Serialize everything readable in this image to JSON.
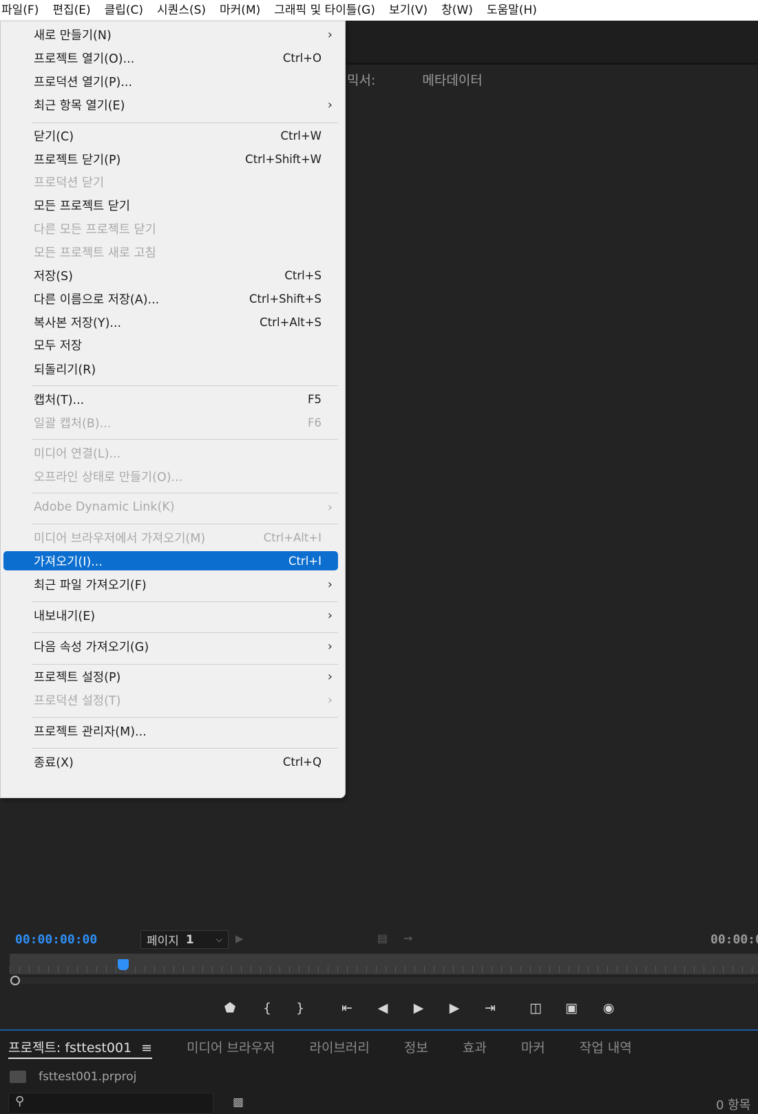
{
  "menubar": {
    "items": [
      "파일(F)",
      "편집(E)",
      "클립(C)",
      "시퀀스(S)",
      "마커(M)",
      "그래픽 및 타이틀(G)",
      "보기(V)",
      "창(W)",
      "도움말(H)"
    ]
  },
  "panel_tabs": [
    "믹서:",
    "메타데이터"
  ],
  "file_menu": {
    "items": [
      {
        "label": "새로 만들기(N)",
        "shortcut": "",
        "submenu": "›"
      },
      {
        "label": "프로젝트 열기(O)...",
        "shortcut": "Ctrl+O",
        "submenu": ""
      },
      {
        "label": "프로덕션 열기(P)...",
        "shortcut": "",
        "submenu": ""
      },
      {
        "label": "최근 항목 열기(E)",
        "shortcut": "",
        "submenu": "›"
      },
      {
        "label": "닫기(C)",
        "shortcut": "Ctrl+W",
        "submenu": ""
      },
      {
        "label": "프로젝트 닫기(P)",
        "shortcut": "Ctrl+Shift+W",
        "submenu": ""
      },
      {
        "label": "프로덕션 닫기",
        "shortcut": "",
        "submenu": ""
      },
      {
        "label": "모든 프로젝트 닫기",
        "shortcut": "",
        "submenu": ""
      },
      {
        "label": "다른 모든 프로젝트 닫기",
        "shortcut": "",
        "submenu": ""
      },
      {
        "label": "모든 프로젝트 새로 고침",
        "shortcut": "",
        "submenu": ""
      },
      {
        "label": "저장(S)",
        "shortcut": "Ctrl+S",
        "submenu": ""
      },
      {
        "label": "다른 이름으로 저장(A)...",
        "shortcut": "Ctrl+Shift+S",
        "submenu": ""
      },
      {
        "label": "복사본 저장(Y)...",
        "shortcut": "Ctrl+Alt+S",
        "submenu": ""
      },
      {
        "label": "모두 저장",
        "shortcut": "",
        "submenu": ""
      },
      {
        "label": "되돌리기(R)",
        "shortcut": "",
        "submenu": ""
      },
      {
        "label": "캡처(T)...",
        "shortcut": "F5",
        "submenu": ""
      },
      {
        "label": "일괄 캡처(B)...",
        "shortcut": "F6",
        "submenu": ""
      },
      {
        "label": "미디어 연결(L)...",
        "shortcut": "",
        "submenu": ""
      },
      {
        "label": "오프라인 상태로 만들기(O)...",
        "shortcut": "",
        "submenu": ""
      },
      {
        "label": "Adobe Dynamic Link(K)",
        "shortcut": "",
        "submenu": "›"
      },
      {
        "label": "미디어 브라우저에서 가져오기(M)",
        "shortcut": "Ctrl+Alt+I",
        "submenu": ""
      },
      {
        "label": "가져오기(I)...",
        "shortcut": "Ctrl+I",
        "submenu": ""
      },
      {
        "label": "최근 파일 가져오기(F)",
        "shortcut": "",
        "submenu": "›"
      },
      {
        "label": "내보내기(E)",
        "shortcut": "",
        "submenu": "›"
      },
      {
        "label": "다음 속성 가져오기(G)",
        "shortcut": "",
        "submenu": "›"
      },
      {
        "label": "프로젝트 설정(P)",
        "shortcut": "",
        "submenu": "›"
      },
      {
        "label": "프로덕션 설정(T)",
        "shortcut": "",
        "submenu": "›"
      },
      {
        "label": "프로젝트 관리자(M)...",
        "shortcut": "",
        "submenu": ""
      },
      {
        "label": "종료(X)",
        "shortcut": "Ctrl+Q",
        "submenu": ""
      }
    ]
  },
  "monitor": {
    "timecode_left": "00:00:00:00",
    "timecode_right": "00:00:0",
    "page_label": "페이지",
    "page_value": "1"
  },
  "project_panel": {
    "tabs": [
      "프로젝트: fsttest001",
      "미디어 브라우저",
      "라이브러리",
      "정보",
      "효과",
      "마커",
      "작업 내역"
    ],
    "project_file": "fsttest001.prproj",
    "item_count": "0 항목"
  },
  "colors": {
    "accent": "#0c6fd0",
    "timecode": "#2f8ff5",
    "menu_bg": "#f0f0f0",
    "app_bg": "#232323"
  }
}
